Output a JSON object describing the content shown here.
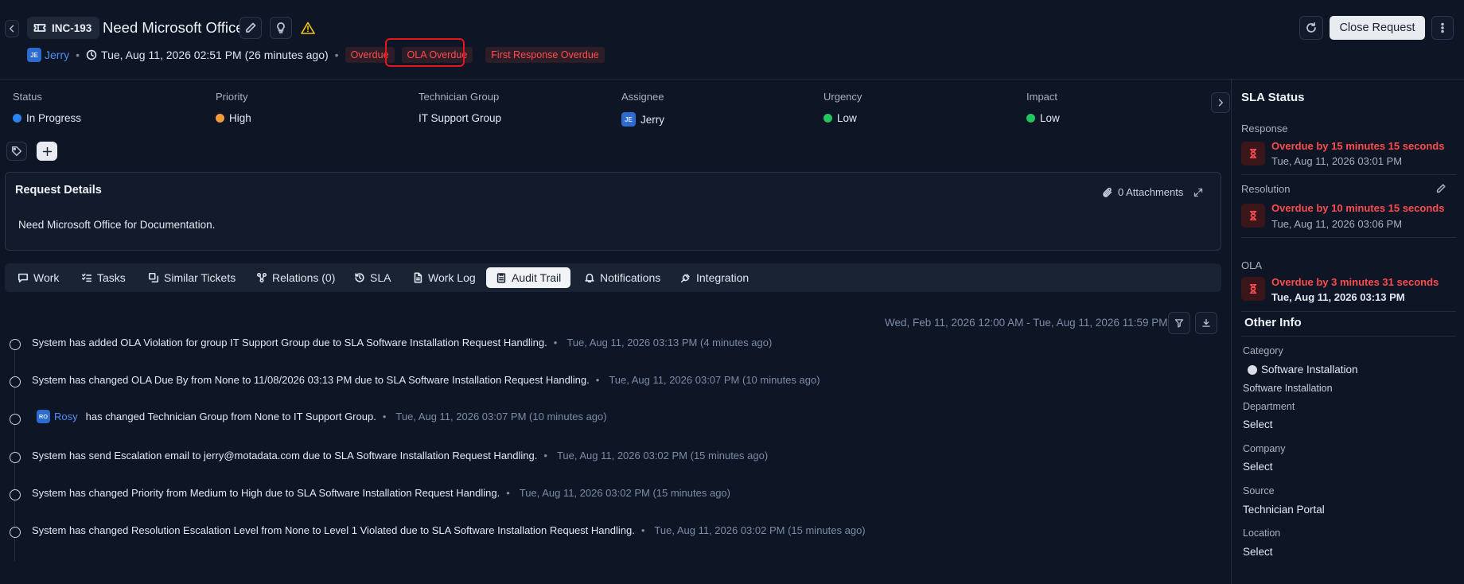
{
  "header": {
    "ticket_id": "INC-193",
    "title": "Need Microsoft Office",
    "requester_initials": "JE",
    "requester": "Jerry",
    "created": "Tue, Aug 11, 2026 02:51 PM (26 minutes ago)",
    "badges": [
      "Overdue",
      "OLA Overdue",
      "First Response Overdue"
    ],
    "close_label": "Close Request"
  },
  "fields": [
    {
      "label": "Status",
      "value": "In Progress",
      "color": "#2b84f0"
    },
    {
      "label": "Priority",
      "value": "High",
      "color": "#f59a3c"
    },
    {
      "label": "Technician Group",
      "value": "IT Support Group"
    },
    {
      "label": "Assignee",
      "value": "Jerry",
      "initials": "JE"
    },
    {
      "label": "Urgency",
      "value": "Low",
      "color": "#22c55e"
    },
    {
      "label": "Impact",
      "value": "Low",
      "color": "#22c55e"
    }
  ],
  "details": {
    "title": "Request Details",
    "attachments": "0 Attachments",
    "description": "Need Microsoft Office for Documentation."
  },
  "tabs": [
    "Work",
    "Tasks",
    "Similar Tickets",
    "Relations (0)",
    "SLA",
    "Work Log",
    "Audit Trail",
    "Notifications",
    "Integration"
  ],
  "active_tab": "Audit Trail",
  "audit": {
    "range": "Wed, Feb 11, 2026 12:00 AM - Tue, Aug 11, 2026 11:59 PM",
    "entries": [
      {
        "text": "System has added OLA Violation for group IT Support Group due to SLA Software Installation Request Handling.",
        "time": "Tue, Aug 11, 2026 03:13 PM (4 minutes ago)"
      },
      {
        "text": "System has changed OLA Due By from None to 11/08/2026 03:13 PM due to SLA Software Installation Request Handling.",
        "time": "Tue, Aug 11, 2026 03:07 PM (10 minutes ago)"
      },
      {
        "user_initials": "RO",
        "user": "Rosy",
        "text": "has changed Technician Group from None to IT Support Group.",
        "time": "Tue, Aug 11, 2026 03:07 PM (10 minutes ago)"
      },
      {
        "text": "System has send Escalation email to jerry@motadata.com due to SLA Software Installation Request Handling.",
        "time": "Tue, Aug 11, 2026 03:02 PM (15 minutes ago)"
      },
      {
        "text": "System has changed Priority from Medium to High due to SLA Software Installation Request Handling.",
        "time": "Tue, Aug 11, 2026 03:02 PM (15 minutes ago)"
      },
      {
        "text": "System has changed Resolution Escalation Level from None to Level 1 Violated due to SLA Software Installation Request Handling.",
        "time": "Tue, Aug 11, 2026 03:02 PM (15 minutes ago)"
      }
    ]
  },
  "sla": {
    "title": "SLA Status",
    "items": [
      {
        "label": "Response",
        "overdue": "Overdue by 15 minutes 15 seconds",
        "date": "Tue, Aug 11, 2026 03:01 PM"
      },
      {
        "label": "Resolution",
        "overdue": "Overdue by 10 minutes 15 seconds",
        "date": "Tue, Aug 11, 2026 03:06 PM"
      },
      {
        "label": "OLA",
        "overdue": "Overdue by 3 minutes 31 seconds",
        "date": "Tue, Aug 11, 2026 03:13 PM"
      }
    ]
  },
  "other_info": {
    "title": "Other Info",
    "category_label": "Category",
    "category_value": "Software Installation",
    "category_sub": "Software Installation",
    "department_label": "Department",
    "department_value": "Select",
    "company_label": "Company",
    "company_value": "Select",
    "source_label": "Source",
    "source_value": "Technician Portal",
    "location_label": "Location",
    "location_value": "Select"
  },
  "colors": {
    "overdue": "#ff4d4f",
    "highlight": "#e5151b",
    "accent": "#4d8ff5"
  }
}
